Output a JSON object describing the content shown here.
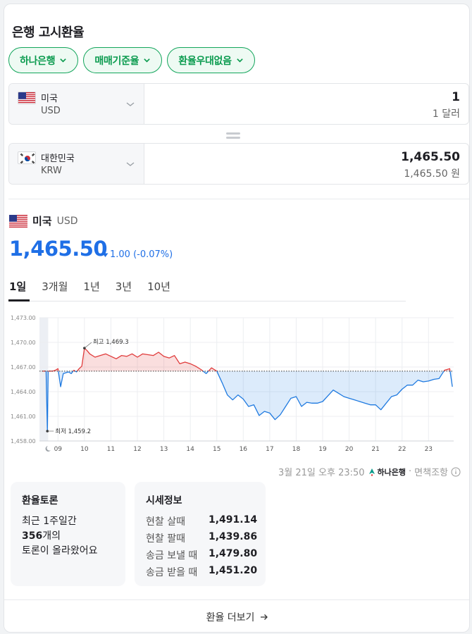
{
  "title": "은행 고시환율",
  "filters": [
    {
      "label": "하나은행"
    },
    {
      "label": "매매기준율"
    },
    {
      "label": "환율우대없음"
    }
  ],
  "converter": {
    "from": {
      "name": "미국",
      "code": "USD",
      "amount": "1",
      "sub": "1 달러"
    },
    "to": {
      "name": "대한민국",
      "code": "KRW",
      "amount": "1,465.50",
      "sub": "1,465.50 원"
    }
  },
  "rate": {
    "country": "미국",
    "code": "USD",
    "value": "1,465.50",
    "change": "1.00 (-0.07%)",
    "direction": "down",
    "color": "#1f6fe6"
  },
  "periods": [
    "1일",
    "3개월",
    "1년",
    "3년",
    "10년"
  ],
  "active_period": "1일",
  "chart_data": {
    "type": "line",
    "ylim": [
      1458,
      1473
    ],
    "yticks": [
      "1,458.00",
      "1,461.00",
      "1,464.00",
      "1,467.00",
      "1,470.00",
      "1,473.00"
    ],
    "x_labels": [
      "09",
      "10",
      "11",
      "12",
      "13",
      "14",
      "15",
      "16",
      "17",
      "18",
      "19",
      "20",
      "21",
      "22",
      "23"
    ],
    "baseline": 1466.5,
    "high": {
      "label": "최고 1,469.3",
      "value": 1469.3
    },
    "low": {
      "label": "최저 1,459.2",
      "value": 1459.2
    },
    "up_color": "#e03b3b",
    "down_color": "#1f7ae0",
    "series": [
      {
        "x": [
          8.4,
          8.55,
          8.6,
          8.63,
          8.7,
          8.8,
          8.9,
          9.0,
          9.1,
          9.2,
          9.3,
          9.4,
          9.5,
          9.6,
          9.7,
          9.8,
          9.9,
          10.0,
          10.1,
          10.2,
          10.4,
          10.6,
          10.8,
          11.0,
          11.2,
          11.4,
          11.6,
          11.8,
          12.0,
          12.2,
          12.4,
          12.6,
          12.8,
          13.0,
          13.2,
          13.4,
          13.6,
          13.8,
          14.0,
          14.2,
          14.4,
          14.6,
          14.8,
          15.0,
          15.2,
          15.4,
          15.6,
          15.8,
          16.0,
          16.2,
          16.4,
          16.6,
          16.8,
          17.0,
          17.2,
          17.4,
          17.6,
          17.8,
          18.0,
          18.2,
          18.4,
          18.6,
          18.8,
          19.0,
          19.2,
          19.4,
          19.6,
          19.8,
          20.0,
          20.2,
          20.4,
          20.6,
          20.8,
          21.0,
          21.2,
          21.4,
          21.6,
          21.8,
          22.0,
          22.2,
          22.4,
          22.6,
          22.8,
          23.0,
          23.2,
          23.4,
          23.6,
          23.8,
          23.9
        ],
        "y": [
          1466.5,
          1466.5,
          1459.2,
          1466.5,
          1466.5,
          1466.5,
          1466.6,
          1466.8,
          1464.6,
          1466.2,
          1466.3,
          1466.4,
          1466.2,
          1466.6,
          1466.4,
          1466.8,
          1467.1,
          1469.3,
          1469.0,
          1468.6,
          1468.2,
          1468.4,
          1468.6,
          1468.3,
          1468.0,
          1468.4,
          1468.3,
          1468.6,
          1468.2,
          1468.6,
          1468.5,
          1468.4,
          1468.8,
          1468.3,
          1468.1,
          1468.4,
          1467.4,
          1467.6,
          1467.4,
          1467.1,
          1466.7,
          1466.2,
          1466.9,
          1466.5,
          1465.1,
          1463.6,
          1463.0,
          1463.6,
          1463.1,
          1462.2,
          1462.4,
          1461.1,
          1461.6,
          1461.4,
          1460.6,
          1461.2,
          1462.2,
          1463.2,
          1463.4,
          1462.2,
          1462.7,
          1462.6,
          1462.6,
          1462.8,
          1463.5,
          1464.2,
          1463.8,
          1463.4,
          1463.2,
          1463.0,
          1462.8,
          1462.6,
          1462.4,
          1462.4,
          1461.8,
          1462.6,
          1463.4,
          1463.6,
          1464.3,
          1464.8,
          1464.8,
          1465.4,
          1465.2,
          1465.3,
          1465.5,
          1465.6,
          1466.6,
          1466.8,
          1464.6
        ]
      }
    ]
  },
  "source": {
    "time": "3월 21일 오후 23:50",
    "bank": "하나은행",
    "disclaimer": "면책조항"
  },
  "forum": {
    "title": "환율토론",
    "line1": "최근 1주일간",
    "count": "356",
    "count_suffix": "개의",
    "line3": "토론이 올라왔어요"
  },
  "prices": {
    "title": "시세정보",
    "rows": [
      {
        "k": "현찰 살때",
        "v": "1,491.14"
      },
      {
        "k": "현찰 팔때",
        "v": "1,439.86"
      },
      {
        "k": "송금 보낼 때",
        "v": "1,479.80"
      },
      {
        "k": "송금 받을 때",
        "v": "1,451.20"
      }
    ]
  },
  "more_label": "환율 더보기",
  "accent": "#12a55b"
}
